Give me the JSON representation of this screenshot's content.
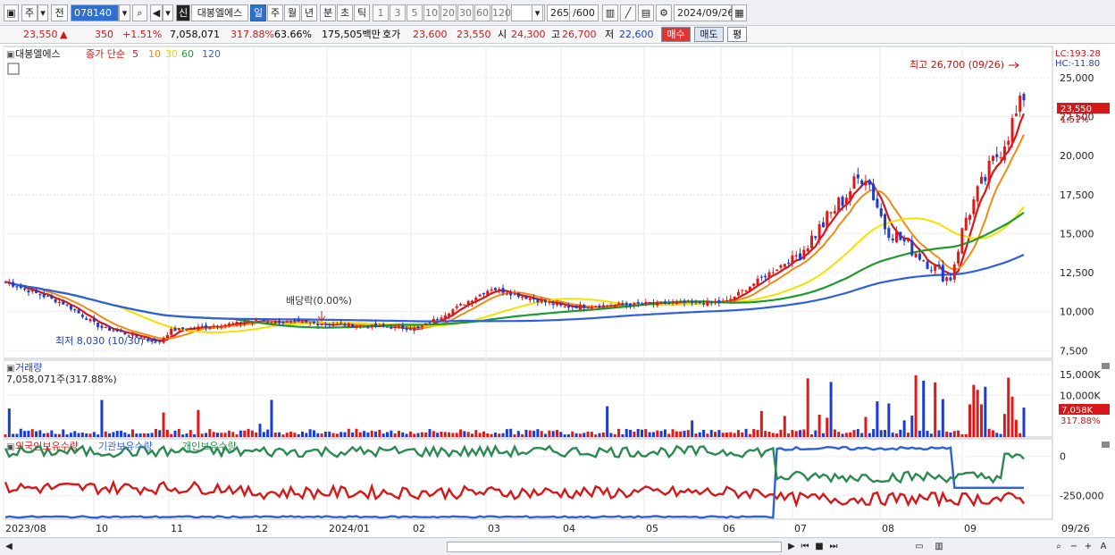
{
  "toolbar": {
    "market": "주",
    "prev": "전",
    "code": "078140",
    "badge": "신",
    "name": "대봉엘에스",
    "periods": [
      "일",
      "주",
      "월",
      "년",
      "분",
      "초",
      "틱"
    ],
    "active_period": "일",
    "intervals": [
      "1",
      "3",
      "5",
      "10",
      "20",
      "30",
      "60",
      "120"
    ],
    "count": "265",
    "count_total": "/600",
    "date": "2024/09/26"
  },
  "quote": {
    "price": "23,550",
    "arrow": "▲",
    "change": "350",
    "change_pct": "+1.51%",
    "volume": "7,058,071",
    "vol_ratio": "317.88%",
    "turnover_ratio": "63.66%",
    "amount": "175,505백만",
    "hoga_label": "호가",
    "ask": "23,600",
    "bid": "23,550",
    "open_label": "시",
    "open": "24,300",
    "high_label": "고",
    "high": "26,700",
    "low_label": "저",
    "low": "22,600",
    "buy": "매수",
    "sell": "매도",
    "eval": "평"
  },
  "legend": {
    "name": "대봉엘에스",
    "ma_label": "종가 단순",
    "ma_periods": [
      "5",
      "10",
      "30",
      "60",
      "120"
    ]
  },
  "colors": {
    "up": "#e01818",
    "down": "#1a3cd0",
    "ma5": "#d81818",
    "ma10": "#f08a14",
    "ma30": "#f2e200",
    "ma60": "#1d9a30",
    "ma120": "#2f5fe0",
    "foreign": "#d81818",
    "inst": "#2f5fe0",
    "indiv": "#2a8a50"
  },
  "annotations": {
    "high": "최고 26,700 (09/26)",
    "low": "최저 8,030 (10/30)",
    "dividend": "배당락(0.00%)",
    "lc": "LC:193.28",
    "hc": "HC:-11.80",
    "price_tag": "23,550",
    "price_pct": "1.51%"
  },
  "volume_panel": {
    "title": "거래량",
    "value": "7,058,071주(317.88%)",
    "tag": "7,058K",
    "tag_pct": "317.88%"
  },
  "holding_panel": {
    "foreign": "외국인보유수량",
    "inst": "기관보유수량",
    "indiv": "개인보유수량"
  },
  "chart_data": [
    {
      "type": "candlestick",
      "title": "대봉엘에스",
      "series": [
        {
          "name": "대봉엘에스",
          "anchors": [
            [
              "2023/08",
              11900
            ],
            [
              "2023/09",
              10500
            ],
            [
              "10",
              9000
            ],
            [
              "10/30",
              8030
            ],
            [
              "11",
              8800
            ],
            [
              "12",
              9400
            ],
            [
              "2024/01",
              9200
            ],
            [
              "02",
              8900
            ],
            [
              "03",
              11500
            ],
            [
              "04",
              10300
            ],
            [
              "05",
              10500
            ],
            [
              "06",
              10600
            ],
            [
              "07",
              13800
            ],
            [
              "07/25",
              19000
            ],
            [
              "08",
              15500
            ],
            [
              "08/26",
              12000
            ],
            [
              "09",
              16000
            ],
            [
              "09/26",
              23550
            ]
          ]
        },
        {
          "name": "5",
          "type": "line"
        },
        {
          "name": "10",
          "type": "line"
        },
        {
          "name": "30",
          "type": "line"
        },
        {
          "name": "60",
          "type": "line"
        },
        {
          "name": "120",
          "type": "line"
        }
      ],
      "ylim": [
        7000,
        27000
      ],
      "y_ticks": [
        7500,
        10000,
        12500,
        15000,
        17500,
        20000,
        22500,
        25000
      ],
      "y_tick_labels": [
        "7,500",
        "10,000",
        "12,500",
        "15,000",
        "17,500",
        "20,000",
        "22,500",
        "25,000"
      ]
    },
    {
      "type": "bar",
      "title": "거래량",
      "y_ticks": [
        10000,
        15000
      ],
      "y_tick_labels": [
        "10,000K",
        "15,000K"
      ],
      "last_value": 7058
    },
    {
      "type": "line",
      "series": [
        {
          "name": "외국인보유수량"
        },
        {
          "name": "기관보유수량"
        },
        {
          "name": "개인보유수량"
        }
      ],
      "y_ticks": [
        0,
        -250000
      ],
      "y_tick_labels": [
        "0",
        "-250,000"
      ]
    }
  ],
  "x_axis": {
    "labels": [
      "2023/08",
      "10",
      "11",
      "12",
      "2024/01",
      "02",
      "03",
      "04",
      "05",
      "06",
      "07",
      "08",
      "09",
      "09/26"
    ]
  }
}
